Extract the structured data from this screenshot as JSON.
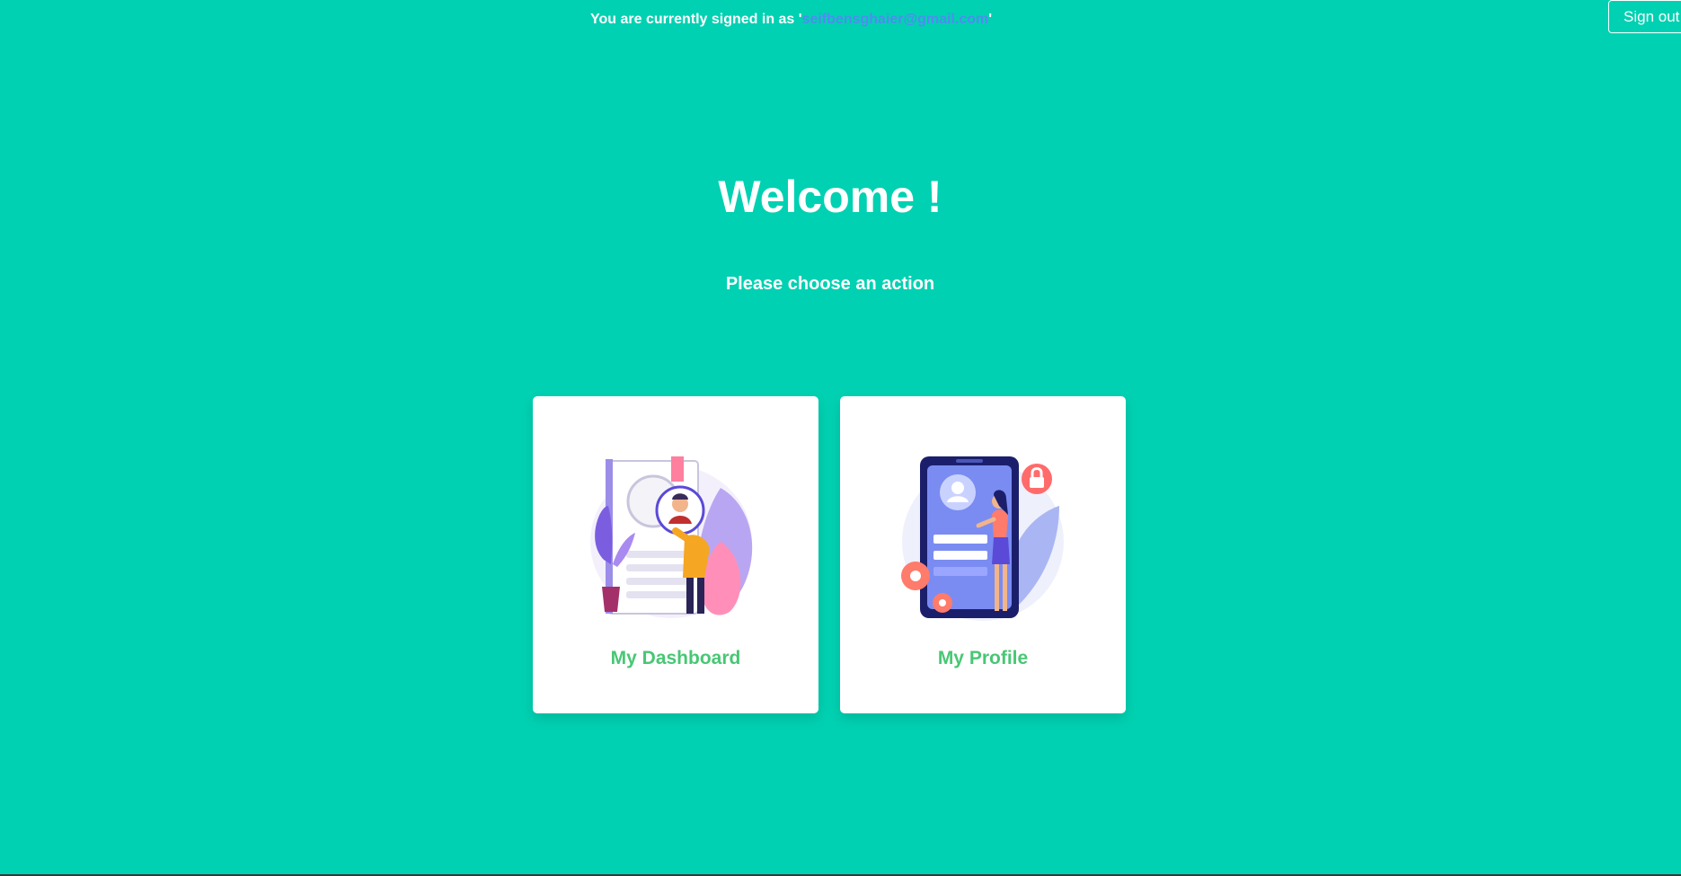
{
  "header": {
    "signed_in_prefix": "You are currently signed in as '",
    "email": "seifbensghaier@gmail.com",
    "signed_in_suffix": "'",
    "signout_label": "Sign out"
  },
  "main": {
    "title": "Welcome !",
    "subtitle": "Please choose an action",
    "cards": [
      {
        "label": "My Dashboard",
        "icon": "dashboard-illustration-icon"
      },
      {
        "label": "My Profile",
        "icon": "profile-illustration-icon"
      }
    ]
  },
  "colors": {
    "background": "#00d1b2",
    "card_label": "#48c774",
    "email_link": "#4f8cf0"
  }
}
